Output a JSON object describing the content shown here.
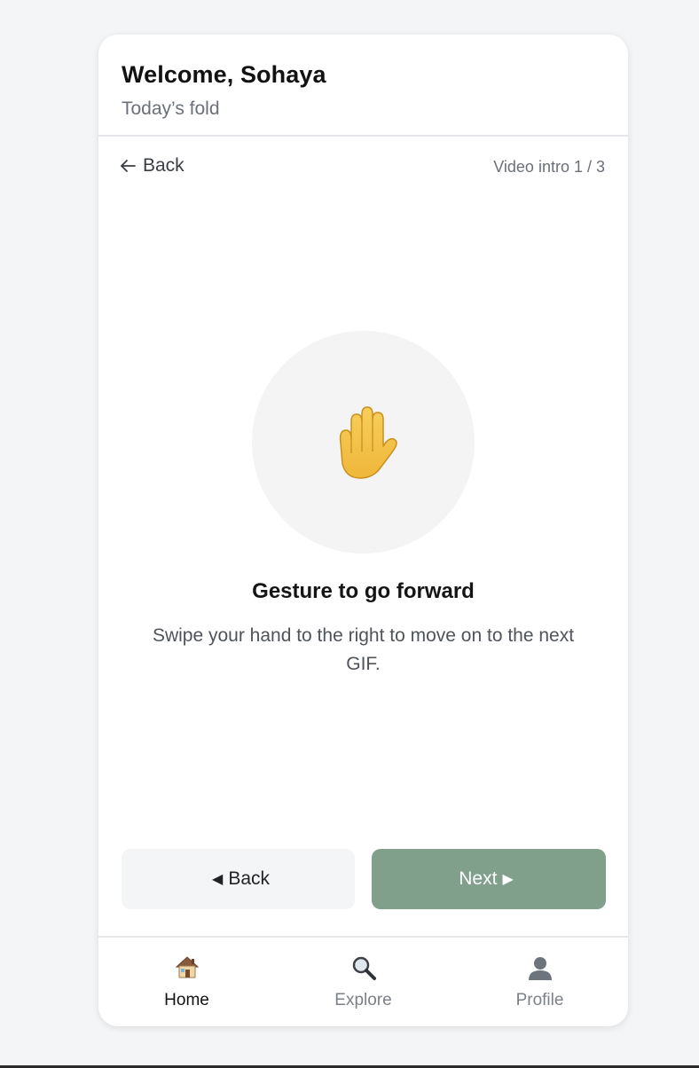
{
  "header": {
    "welcome": "Welcome, Sohaya",
    "subtitle": "Today’s fold"
  },
  "topbar": {
    "back_label": "Back",
    "step": "Video intro 1 / 3",
    "back_icon": "arrow-left-icon"
  },
  "hero": {
    "icon": "raised-hand-icon",
    "title": "Gesture to go forward",
    "description": "Swipe your hand to the right to move on to the next GIF."
  },
  "actions": {
    "back_label": "Back",
    "back_icon": "◀",
    "next_label": "Next",
    "next_icon": "▶"
  },
  "tabs": [
    {
      "label": "Home",
      "icon": "house-icon",
      "active": true
    },
    {
      "label": "Explore",
      "icon": "magnifier-icon",
      "active": false
    },
    {
      "label": "Profile",
      "icon": "person-icon",
      "active": false
    }
  ],
  "colors": {
    "page_background": "#f4f5f7",
    "card_background": "#ffffff",
    "next_button": "#80a08c",
    "back_button": "#f4f5f6",
    "hero_circle": "#f3f4f3"
  }
}
